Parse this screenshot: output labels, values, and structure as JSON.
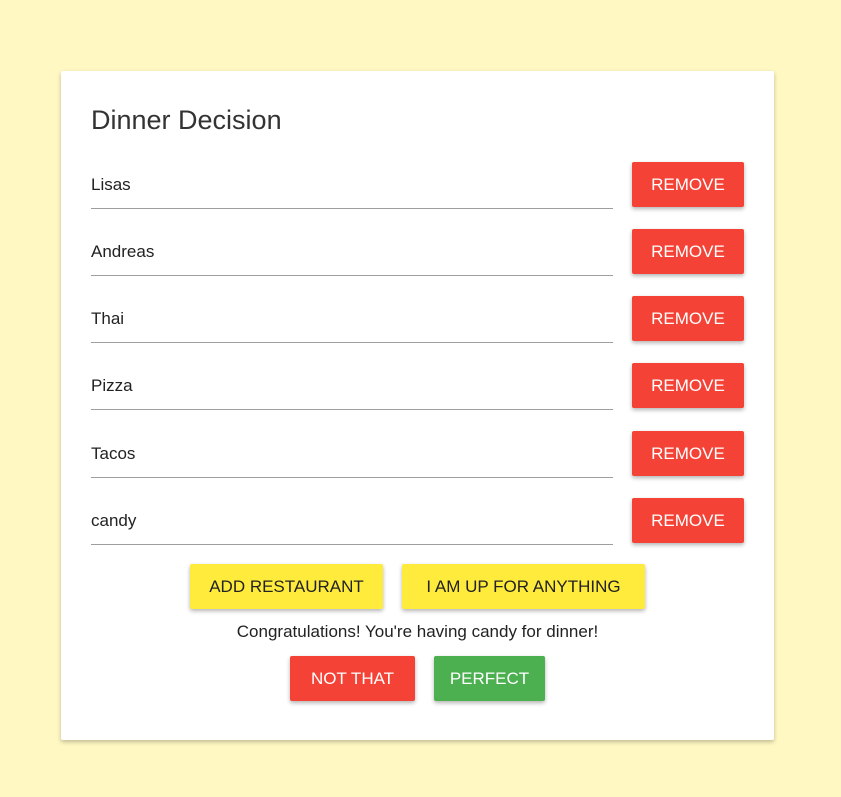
{
  "title": "Dinner Decision",
  "restaurants": [
    {
      "name": "Lisas",
      "remove_label": "Remove"
    },
    {
      "name": "Andreas",
      "remove_label": "Remove"
    },
    {
      "name": "Thai",
      "remove_label": "Remove"
    },
    {
      "name": "Pizza",
      "remove_label": "Remove"
    },
    {
      "name": "Tacos",
      "remove_label": "Remove"
    },
    {
      "name": "candy",
      "remove_label": "Remove"
    }
  ],
  "actions": {
    "add_label": "Add Restaurant",
    "anything_label": "I am up for anything"
  },
  "result": {
    "message": "Congratulations! You're having candy for dinner!",
    "reject_label": "Not that",
    "accept_label": "Perfect"
  },
  "colors": {
    "background": "#fff8c2",
    "remove": "#f44336",
    "accept": "#4caf50",
    "primary": "#ffeb3b"
  }
}
